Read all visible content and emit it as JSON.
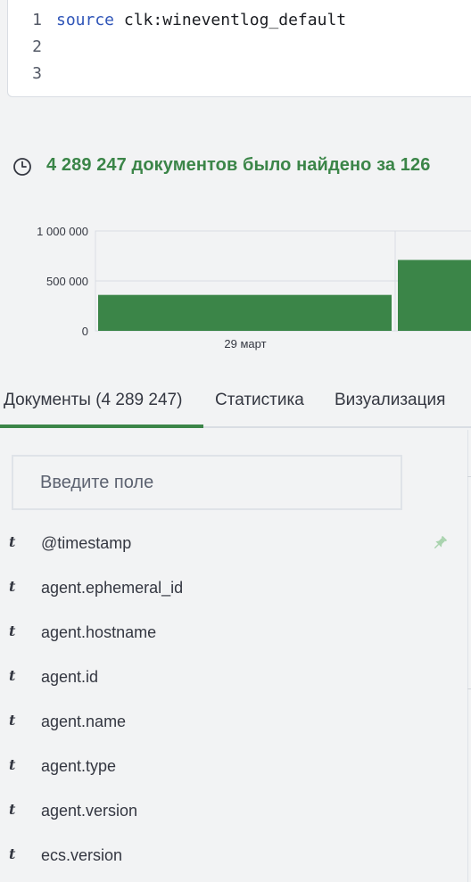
{
  "query": {
    "lines": [
      {
        "num": "1",
        "keyword": "source",
        "rest": " clk:wineventlog_default"
      },
      {
        "num": "2",
        "keyword": "",
        "rest": ""
      },
      {
        "num": "3",
        "keyword": "",
        "rest": ""
      }
    ]
  },
  "summary": {
    "icon": "clock-icon",
    "text": "4 289 247 документов было найдено за 126"
  },
  "chart_data": {
    "type": "bar",
    "categories": [
      "29 март",
      ""
    ],
    "values": [
      360000,
      710000
    ],
    "y_ticks": [
      "1 000 000",
      "500 000",
      "0"
    ],
    "ylim": [
      0,
      1000000
    ],
    "x_tick_label": "29 март",
    "bar_color": "#3b8548",
    "grid": true
  },
  "tabs": [
    {
      "label": "Документы (4 289 247)",
      "active": true
    },
    {
      "label": "Статистика",
      "active": false
    },
    {
      "label": "Визуализация",
      "active": false
    }
  ],
  "field_search": {
    "placeholder": "Введите поле"
  },
  "fields": [
    {
      "type": "t",
      "name": "@timestamp",
      "pinned": true
    },
    {
      "type": "t",
      "name": "agent.ephemeral_id",
      "pinned": false
    },
    {
      "type": "t",
      "name": "agent.hostname",
      "pinned": false
    },
    {
      "type": "t",
      "name": "agent.id",
      "pinned": false
    },
    {
      "type": "t",
      "name": "agent.name",
      "pinned": false
    },
    {
      "type": "t",
      "name": "agent.type",
      "pinned": false
    },
    {
      "type": "t",
      "name": "agent.version",
      "pinned": false
    },
    {
      "type": "t",
      "name": "ecs.version",
      "pinned": false
    }
  ],
  "colors": {
    "accent": "#3b8548",
    "pin": "#a9d3ae"
  }
}
